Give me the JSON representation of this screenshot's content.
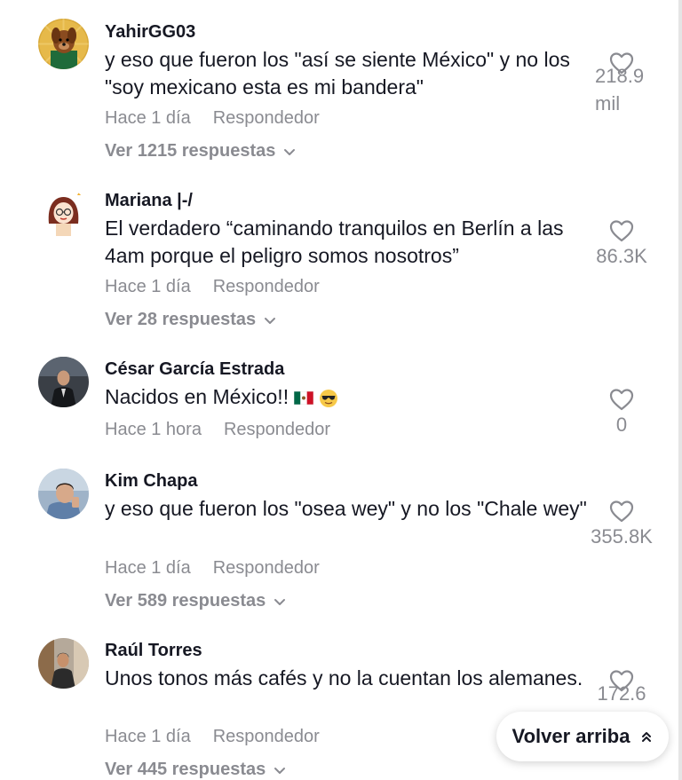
{
  "comments": [
    {
      "username": "YahirGG03",
      "text": "y eso que fueron los \"así se siente México\" y no los \"soy mexicano esta es mi bandera\"",
      "time": "Hace 1 día",
      "reply_label": "Respondedor",
      "replies_label": "Ver 1215 respuestas",
      "likes": "218.9 mil",
      "avatar_icon": "dog-avatar-icon"
    },
    {
      "username": "Mariana |-/",
      "text": "El verdadero “caminando tranquilos en Berlín a las 4am porque el peligro somos nosotros”",
      "time": "Hace 1 día",
      "reply_label": "Respondedor",
      "replies_label": "Ver 28 respuestas",
      "likes": "86.3K",
      "avatar_icon": "cartoon-girl-avatar-icon"
    },
    {
      "username": "César García Estrada",
      "text": "Nacidos en México!!",
      "time": "Hace 1 hora",
      "reply_label": "Respondedor",
      "likes": "0",
      "avatar_icon": "man-suit-avatar-icon",
      "emojis": [
        "mexico-flag-emoji",
        "sunglasses-emoji"
      ]
    },
    {
      "username": "Kim Chapa",
      "text": "y eso que fueron los \"osea wey\" y no los \"Chale wey\"",
      "time": "Hace 1 día",
      "reply_label": "Respondedor",
      "replies_label": "Ver 589 respuestas",
      "likes": "355.8K",
      "avatar_icon": "man-photo-avatar-icon"
    },
    {
      "username": "Raúl Torres",
      "text": "Unos tonos más cafés y no la cuentan los alemanes.",
      "time": "Hace 1 día",
      "reply_label": "Respondedor",
      "replies_label": "Ver 445 respuestas",
      "likes": "172.6",
      "avatar_icon": "man-street-avatar-icon"
    }
  ],
  "back_to_top": {
    "label": "Volver arriba",
    "icon": "double-chevron-up-icon"
  },
  "colors": {
    "text": "#161823",
    "secondary": "#8a8b91",
    "background": "#ffffff"
  }
}
